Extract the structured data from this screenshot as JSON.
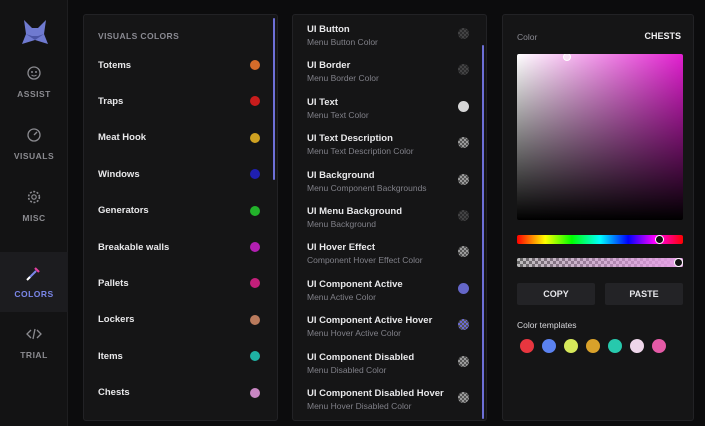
{
  "sidebar": {
    "items": [
      {
        "label": "ASSIST",
        "icon": "face-icon",
        "active": false
      },
      {
        "label": "VISUALS",
        "icon": "gauge-icon",
        "active": false
      },
      {
        "label": "MISC",
        "icon": "gear-icon",
        "active": false
      },
      {
        "label": "COLORS",
        "icon": "eyedropper-icon",
        "active": true
      },
      {
        "label": "TRIAL",
        "icon": "code-icon",
        "active": false
      }
    ]
  },
  "visuals_panel": {
    "header": "VISUALS COLORS",
    "items": [
      {
        "label": "Totems",
        "color": "#d46b2a"
      },
      {
        "label": "Traps",
        "color": "#c81c1c"
      },
      {
        "label": "Meat Hook",
        "color": "#cfa121"
      },
      {
        "label": "Windows",
        "color": "#1f1fb0"
      },
      {
        "label": "Generators",
        "color": "#22b22a"
      },
      {
        "label": "Breakable walls",
        "color": "#b21fb2"
      },
      {
        "label": "Pallets",
        "color": "#c21f7a"
      },
      {
        "label": "Lockers",
        "color": "#b97a5c"
      },
      {
        "label": "Items",
        "color": "#1fb2a4"
      },
      {
        "label": "Chests",
        "color": "#c886c2"
      }
    ]
  },
  "ui_panel": {
    "items": [
      {
        "label": "UI Button",
        "sub": "Menu Button Color",
        "swatch": "checker-dark"
      },
      {
        "label": "UI Border",
        "sub": "Menu Border Color",
        "swatch": "checker-dark"
      },
      {
        "label": "UI Text",
        "sub": "Menu Text Color",
        "swatch": "#d6d6d6"
      },
      {
        "label": "UI Text Description",
        "sub": "Menu Text Description Color",
        "swatch": "checker"
      },
      {
        "label": "UI Background",
        "sub": "Menu Component Backgrounds",
        "swatch": "checker"
      },
      {
        "label": "UI Menu Background",
        "sub": "Menu Background",
        "swatch": "checker-dark"
      },
      {
        "label": "UI Hover Effect",
        "sub": "Component Hover Effect Color",
        "swatch": "checker"
      },
      {
        "label": "UI Component Active",
        "sub": "Menu Active Color",
        "swatch": "#6466c8"
      },
      {
        "label": "UI Component Active Hover",
        "sub": "Menu Hover Active Color",
        "swatch": "checker-blue"
      },
      {
        "label": "UI Component Disabled",
        "sub": "Menu Disabled Color",
        "swatch": "checker"
      },
      {
        "label": "UI Component Disabled Hover",
        "sub": "Menu Hover Disabled Color",
        "swatch": "checker"
      }
    ]
  },
  "picker": {
    "label": "Color",
    "target": "CHESTS",
    "hue_value": 0.86,
    "alpha_value": 1.0,
    "saturation": 0.3,
    "brightness": 1.0,
    "copy_label": "COPY",
    "paste_label": "PASTE",
    "templates_label": "Color templates",
    "templates": [
      "#e8363f",
      "#5b82f0",
      "#d6e85a",
      "#d9a12a",
      "#27c9ad",
      "#eed6ea",
      "#e45aa6"
    ]
  },
  "colors": {
    "accent": "#6d6fd6",
    "background": "#0c0c0d",
    "panel": "#151516"
  }
}
